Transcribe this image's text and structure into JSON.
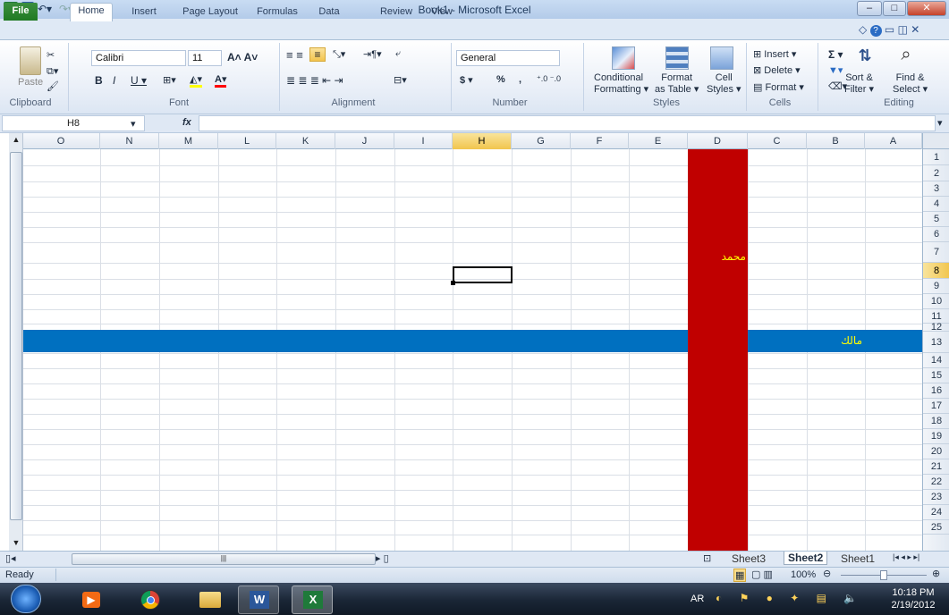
{
  "window": {
    "title": "Book1 - Microsoft Excel"
  },
  "tabs": [
    "File",
    "Home",
    "Insert",
    "Page Layout",
    "Formulas",
    "Data",
    "Review",
    "View"
  ],
  "ribbon": {
    "clipboard": {
      "paste": "Paste",
      "label": "Clipboard"
    },
    "font": {
      "name": "Calibri",
      "size": "11",
      "label": "Font"
    },
    "alignment": {
      "label": "Alignment"
    },
    "number": {
      "format": "General",
      "currency": "$",
      "percent": "%",
      "comma": ",",
      "label": "Number"
    },
    "styles": {
      "conditional": "Conditional",
      "formatting": "Formatting",
      "format": "Format",
      "as_table": "as Table",
      "cell": "Cell",
      "styles": "Styles",
      "label": "Styles"
    },
    "cells": {
      "insert": "Insert",
      "delete": "Delete",
      "format": "Format",
      "label": "Cells"
    },
    "editing": {
      "sigma": "Σ",
      "sort": "Sort &",
      "filter": "Filter",
      "find": "Find &",
      "select": "Select",
      "label": "Editing"
    }
  },
  "formula_bar": {
    "name_box": "H8",
    "fx": "fx",
    "value": ""
  },
  "columns": [
    "O",
    "N",
    "M",
    "L",
    "K",
    "J",
    "I",
    "H",
    "G",
    "F",
    "E",
    "D",
    "C",
    "B",
    "A"
  ],
  "rows": [
    "1",
    "2",
    "3",
    "4",
    "5",
    "6",
    "7",
    "8",
    "9",
    "10",
    "11",
    "12",
    "13",
    "14",
    "15",
    "16",
    "17",
    "18",
    "19",
    "20",
    "21",
    "22",
    "23",
    "24",
    "25"
  ],
  "selected": {
    "cell": "H8",
    "column": "H",
    "row": "8"
  },
  "cells": {
    "D7": {
      "text": "محمد",
      "fill": "#c00000",
      "color": "#ffff00"
    },
    "B12": {
      "text": "مالك",
      "fill": "#0070c0",
      "color": "#ffff00"
    }
  },
  "colors": {
    "column_D_fill": "#c00000",
    "row_12_fill": "#0070c0"
  },
  "sheets": [
    "Sheet3",
    "Sheet2",
    "Sheet1"
  ],
  "active_sheet": "Sheet2",
  "status": {
    "mode": "Ready",
    "zoom": "100%"
  },
  "taskbar": {
    "lang": "AR",
    "time": "10:18 PM",
    "date": "2/19/2012",
    "apps": [
      "start-orb",
      "media-player",
      "chrome",
      "explorer",
      "word",
      "excel"
    ]
  }
}
